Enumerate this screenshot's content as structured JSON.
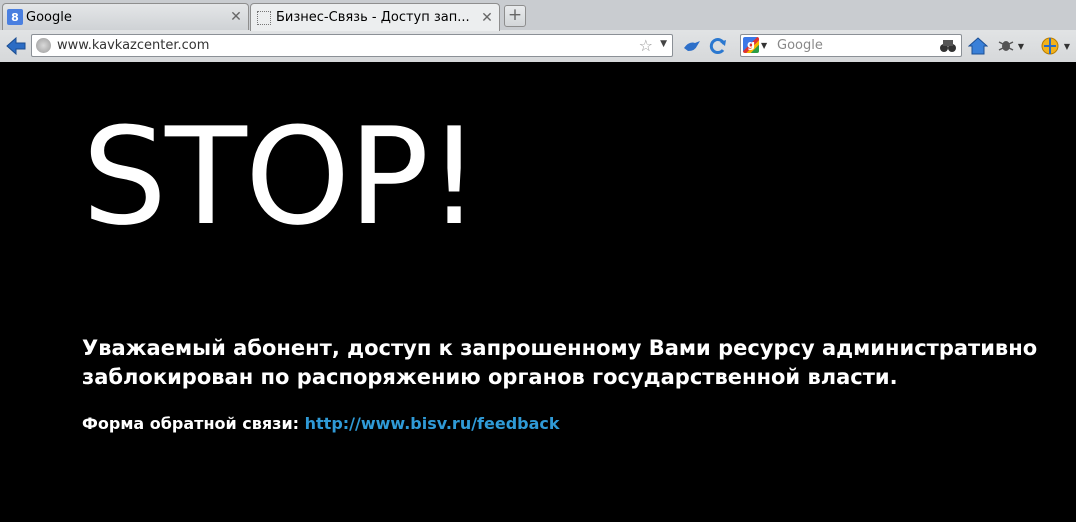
{
  "tabs": [
    {
      "title": "Google",
      "icon": "google-favicon",
      "active": false
    },
    {
      "title": "Бизнес-Связь - Доступ зап...",
      "icon": "blank-page-icon",
      "active": true
    }
  ],
  "address_bar": {
    "url": "www.kavkazcenter.com"
  },
  "search_box": {
    "placeholder": "Google",
    "engine": "Google"
  },
  "page": {
    "heading": "STOP!",
    "message_line1": "Уважаемый абонент, доступ к запрошенному Вами ресурсу административно",
    "message_line2": "заблокирован по распоряжению органов государственной власти.",
    "feedback_label": "Форма обратной связи:",
    "feedback_link": "http://www.bisv.ru/feedback"
  },
  "colors": {
    "background": "#000000",
    "text": "#ffffff",
    "link": "#2f9ad6"
  }
}
